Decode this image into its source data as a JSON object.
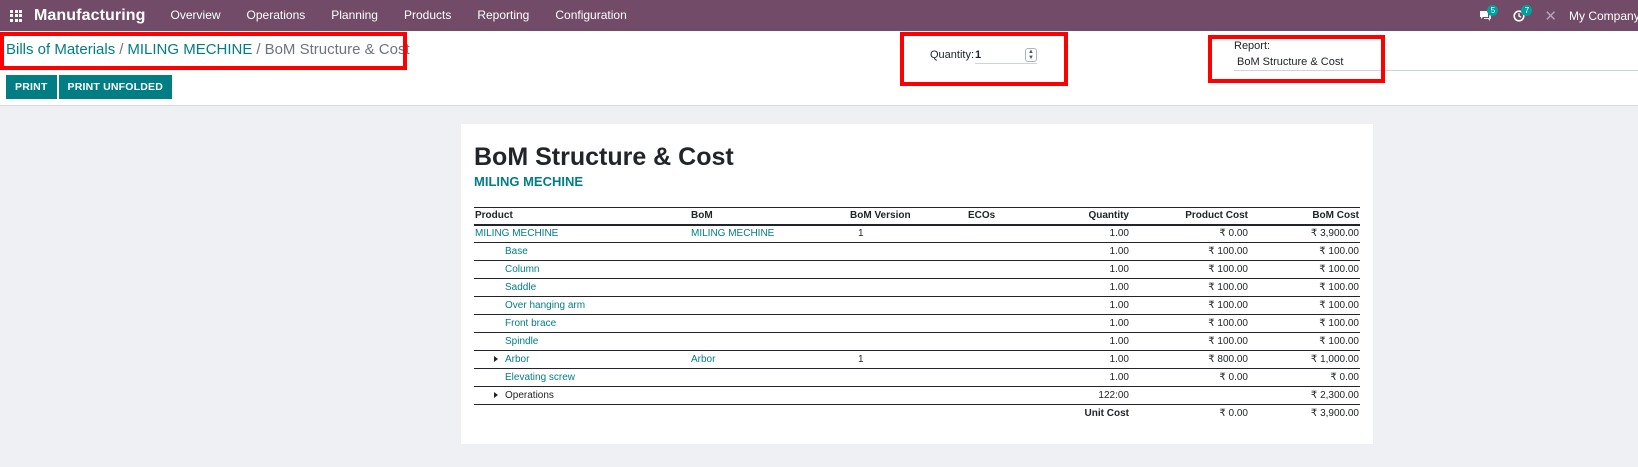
{
  "navbar": {
    "brand": "Manufacturing",
    "menu": [
      "Overview",
      "Operations",
      "Planning",
      "Products",
      "Reporting",
      "Configuration"
    ],
    "messages_badge": "5",
    "activities_badge": "7",
    "company": "My Company (S"
  },
  "breadcrumb": [
    "Bills of Materials",
    "MILING MECHINE",
    "BoM Structure & Cost"
  ],
  "quantity": {
    "label": "Quantity:",
    "value": "1"
  },
  "report": {
    "label": "Report:",
    "value": "BoM Structure & Cost"
  },
  "buttons": {
    "print": "PRINT",
    "print_unfolded": "PRINT UNFOLDED"
  },
  "sheet": {
    "title": "BoM Structure & Cost",
    "subtitle": "MILING MECHINE",
    "columns": [
      "Product",
      "BoM",
      "BoM Version",
      "ECOs",
      "Quantity",
      "Product Cost",
      "BoM Cost"
    ],
    "rows": [
      {
        "product": "MILING MECHINE",
        "bom": "MILING MECHINE",
        "version": "1",
        "ecos": "",
        "quantity": "1.00",
        "product_cost": "₹ 0.00",
        "bom_cost": "₹ 3,900.00"
      },
      {
        "product": "Base",
        "bom": "",
        "version": "",
        "ecos": "",
        "quantity": "1.00",
        "product_cost": "₹ 100.00",
        "bom_cost": "₹ 100.00"
      },
      {
        "product": "Column",
        "bom": "",
        "version": "",
        "ecos": "",
        "quantity": "1.00",
        "product_cost": "₹ 100.00",
        "bom_cost": "₹ 100.00"
      },
      {
        "product": "Saddle",
        "bom": "",
        "version": "",
        "ecos": "",
        "quantity": "1.00",
        "product_cost": "₹ 100.00",
        "bom_cost": "₹ 100.00"
      },
      {
        "product": "Over hanging arm",
        "bom": "",
        "version": "",
        "ecos": "",
        "quantity": "1.00",
        "product_cost": "₹ 100.00",
        "bom_cost": "₹ 100.00"
      },
      {
        "product": "Front brace",
        "bom": "",
        "version": "",
        "ecos": "",
        "quantity": "1.00",
        "product_cost": "₹ 100.00",
        "bom_cost": "₹ 100.00"
      },
      {
        "product": "Spindle",
        "bom": "",
        "version": "",
        "ecos": "",
        "quantity": "1.00",
        "product_cost": "₹ 100.00",
        "bom_cost": "₹ 100.00"
      },
      {
        "product": "Arbor",
        "bom": "Arbor",
        "version": "1",
        "ecos": "",
        "quantity": "1.00",
        "product_cost": "₹ 800.00",
        "bom_cost": "₹ 1,000.00"
      },
      {
        "product": "Elevating screw",
        "bom": "",
        "version": "",
        "ecos": "",
        "quantity": "1.00",
        "product_cost": "₹ 0.00",
        "bom_cost": "₹ 0.00"
      },
      {
        "product": "Operations",
        "bom": "",
        "version": "",
        "ecos": "",
        "quantity": "122:00",
        "product_cost": "",
        "bom_cost": "₹ 2,300.00"
      }
    ],
    "total": {
      "label": "Unit Cost",
      "product_cost": "₹ 0.00",
      "bom_cost": "₹ 3,900.00"
    }
  }
}
